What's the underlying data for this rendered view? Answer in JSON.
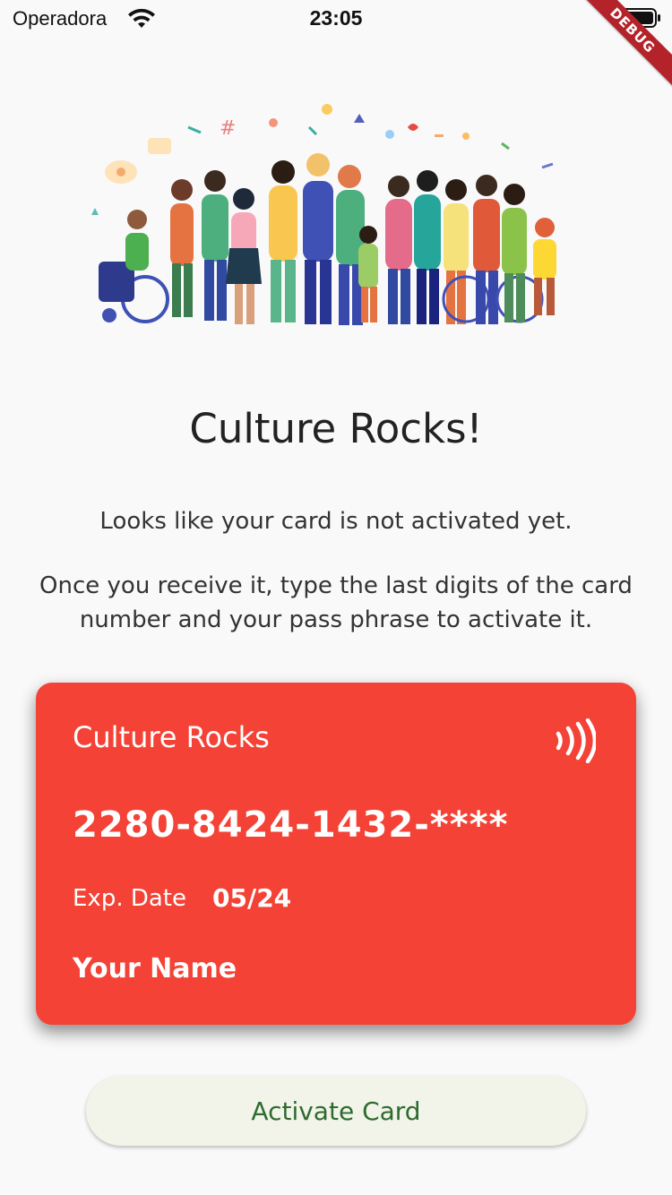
{
  "status_bar": {
    "carrier": "Operadora",
    "time": "23:05"
  },
  "debug_banner": "DEBUG",
  "header": {
    "title": "Culture Rocks!"
  },
  "messages": {
    "line1": "Looks like your card is not activated yet.",
    "line2a": "Once you receive it, type the last digits of the card",
    "line2b": "number and your pass phrase to activate it."
  },
  "card": {
    "brand": "Culture Rocks",
    "number": "2280-8424-1432-****",
    "exp_label": "Exp. Date",
    "exp_value": "05/24",
    "holder": "Your Name",
    "icon": "nfc-icon",
    "color": "#f44336"
  },
  "actions": {
    "activate_label": "Activate Card"
  }
}
